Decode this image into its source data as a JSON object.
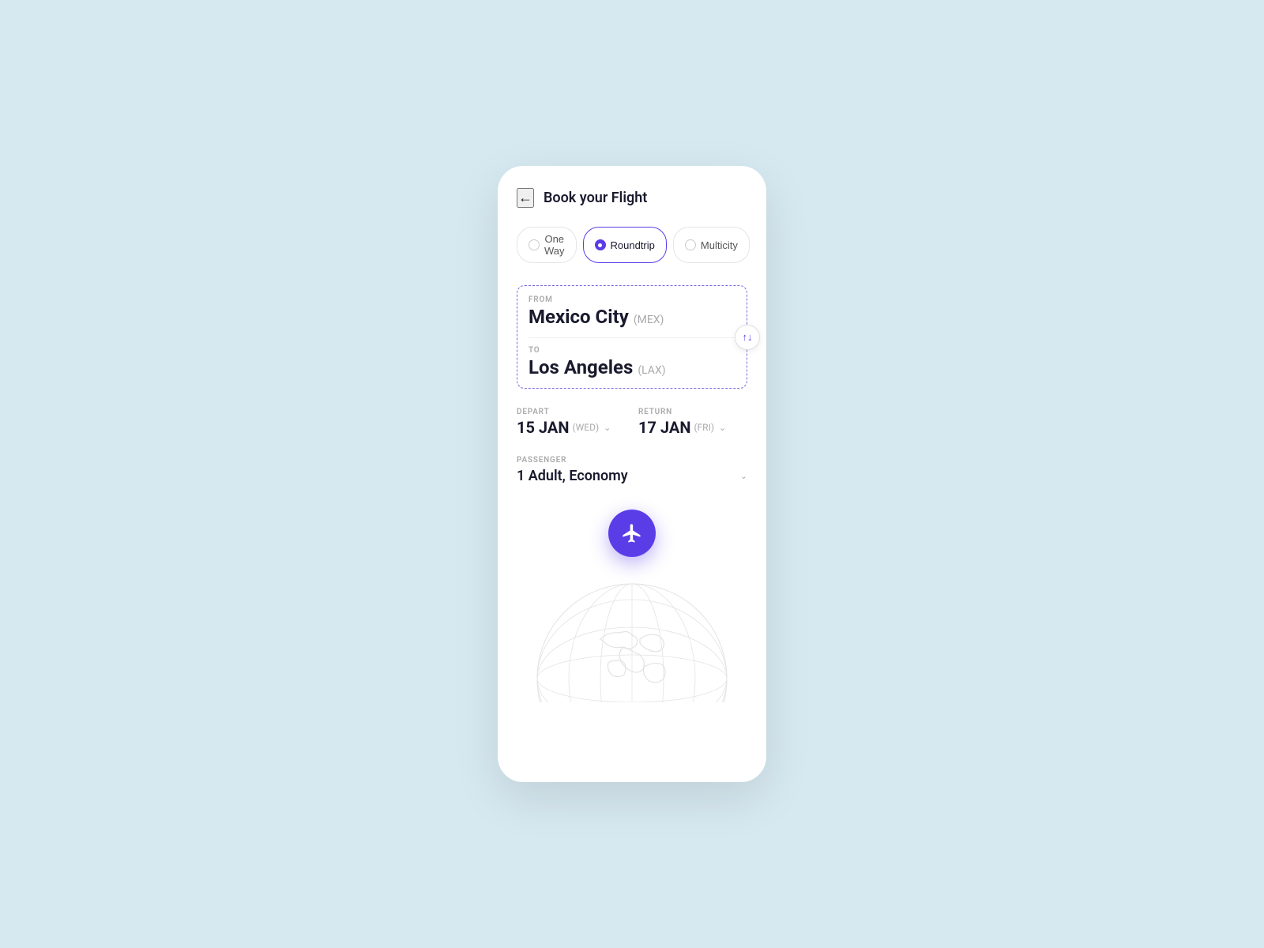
{
  "page": {
    "background_color": "#d6e8f0",
    "accent_color": "#5b3de8"
  },
  "header": {
    "back_label": "←",
    "title": "Book your Flight"
  },
  "trip_types": [
    {
      "id": "one-way",
      "label": "One Way",
      "active": false
    },
    {
      "id": "roundtrip",
      "label": "Roundtrip",
      "active": true
    },
    {
      "id": "multicity",
      "label": "Multicity",
      "active": false
    }
  ],
  "from": {
    "label": "FROM",
    "city": "Mexico City",
    "code": "(MEX)"
  },
  "to": {
    "label": "TO",
    "city": "Los Angeles",
    "code": "(LAX)"
  },
  "swap_label": "↑↓",
  "depart": {
    "label": "DEPART",
    "day": "15 JAN",
    "day_of_week": "(WED)"
  },
  "return": {
    "label": "RETURN",
    "day": "17 JAN",
    "day_of_week": "(FRI)"
  },
  "passenger": {
    "label": "PASSENGER",
    "value": "1 Adult, Economy"
  },
  "search_button_aria": "Search Flights"
}
